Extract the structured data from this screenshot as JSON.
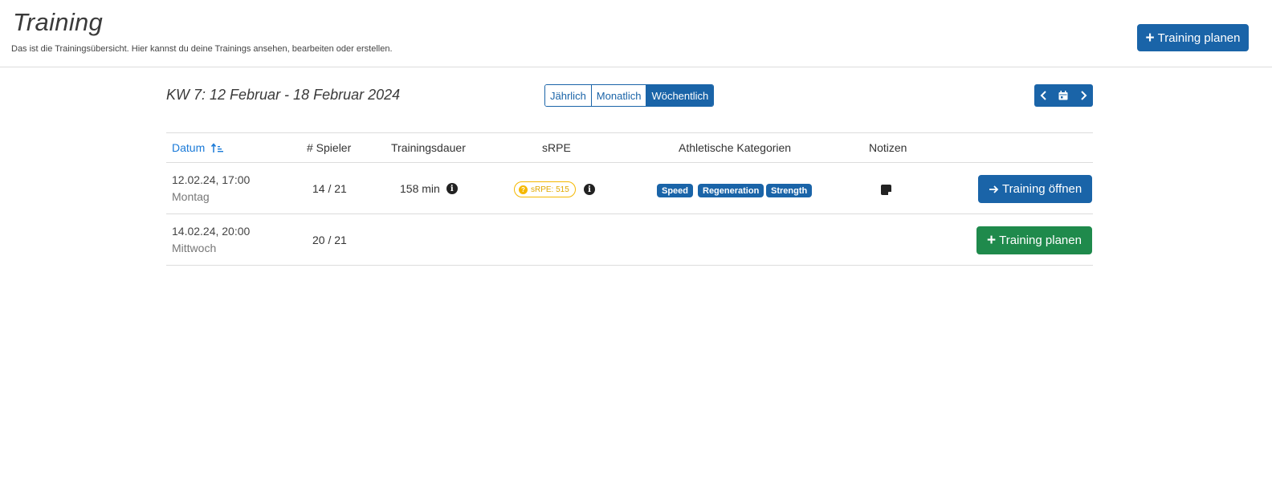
{
  "header": {
    "title": "Training",
    "subtitle": "Das ist die Trainingsübersicht. Hier kannst du deine Trainings ansehen, bearbeiten oder erstellen.",
    "plan_button": "Training planen"
  },
  "toolbar": {
    "week_label": "KW 7: 12 Februar - 18 Februar 2024",
    "view_modes": [
      "Jährlich",
      "Monatlich",
      "Wöchentlich"
    ],
    "active_view": "Wöchentlich"
  },
  "table": {
    "columns": [
      "Datum",
      "# Spieler",
      "Trainingsdauer",
      "sRPE",
      "Athletische Kategorien",
      "Notizen"
    ],
    "rows": [
      {
        "date": "12.02.24, 17:00",
        "weekday": "Montag",
        "players": "14 / 21",
        "duration": "158 min",
        "srpe": "sRPE: 515",
        "categories": [
          "Speed",
          "Regeneration",
          "Strength"
        ],
        "has_note": true,
        "action": "Training öffnen"
      },
      {
        "date": "14.02.24, 20:00",
        "weekday": "Mittwoch",
        "players": "20 / 21",
        "duration": "",
        "srpe": "",
        "categories": [],
        "has_note": false,
        "action": "Training planen"
      }
    ]
  },
  "colors": {
    "primary": "#1a64a8",
    "success": "#1f8a4c",
    "warning": "#f5b800",
    "sort_link": "#1a7ad8"
  },
  "icons": {
    "plus": "plus-icon",
    "arrow": "arrow-right-icon",
    "info": "info-icon",
    "note": "note-icon",
    "sort": "sort-ascending-icon",
    "prev": "chevron-left-icon",
    "next": "chevron-right-icon",
    "calendar": "calendar-icon"
  }
}
